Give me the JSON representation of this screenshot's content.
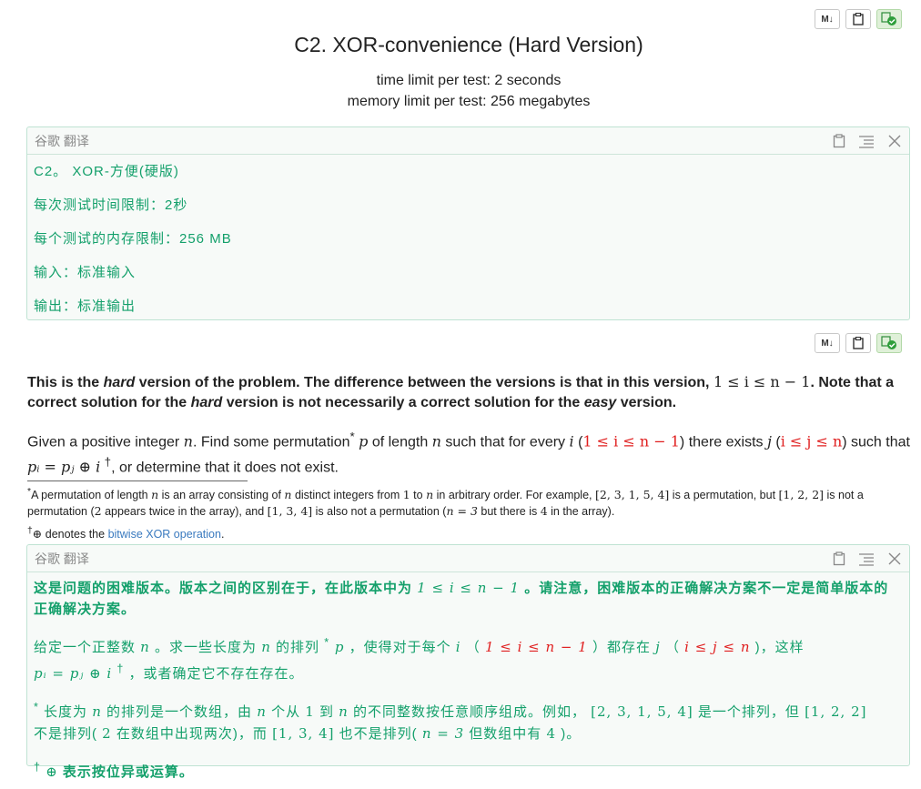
{
  "toolbar": {
    "md_label": "M↓"
  },
  "problem": {
    "title": "C2. XOR-convenience (Hard Version)",
    "time_limit": "time limit per test: 2 seconds",
    "memory_limit": "memory limit per test: 256 megabytes"
  },
  "translation1": {
    "header": "谷歌 翻译",
    "lines": [
      "C2。 XOR-方便(硬版)",
      "每次测试时间限制：2秒",
      "每个测试的内存限制：256 MB",
      "输入：标准输入",
      "输出：标准输出"
    ]
  },
  "statement": {
    "p1": {
      "a": "This is the ",
      "b": "hard",
      "c": " version of the problem. The difference between the versions is that in this version, ",
      "math": "1 ≤ i ≤ n − 1",
      "d": ". Note that a correct solution for the ",
      "e": "hard",
      "f": " version is not necessarily a correct solution for the ",
      "g": "easy",
      "h": " version."
    },
    "p2": {
      "a": "Given a positive integer ",
      "n": "n",
      "b": ". Find some permutation",
      "star": "*",
      "p": "p",
      "c": " of length ",
      "n2": "n",
      "d": " such that for every ",
      "i": "i",
      "e": " (",
      "cond1": "1 ≤ i ≤ n − 1",
      "f": ") there exists ",
      "j": "j",
      "g": " (",
      "cond2": "i ≤ j ≤ n",
      "h": ") such that",
      "eq": "pᵢ = pⱼ ⊕ i",
      "dagger": "†",
      "k": ", or determine that it does not exist."
    }
  },
  "footnotes": {
    "fn1": {
      "mark": "*",
      "a": "A permutation of length ",
      "n": "n",
      "b": " is an array consisting of ",
      "n2": "n",
      "c": " distinct integers from ",
      "one": "1",
      "d": " to ",
      "n3": "n",
      "e": " in arbitrary order. For example, ",
      "ex1": "[2, 3, 1, 5, 4]",
      "f": " is a permutation, but ",
      "ex2": "[1, 2, 2]",
      "g": " is not a permutation (",
      "two": "2",
      "h": " appears twice in the array), and ",
      "ex3": "[1, 3, 4]",
      "i": " is also not a permutation (",
      "n_eq": "n = 3",
      "j": " but there is ",
      "four": "4",
      "k": " in the array)."
    },
    "fn2": {
      "mark": "†",
      "sym": "⊕",
      "a": " denotes the ",
      "link": "bitwise XOR operation",
      "b": "."
    }
  },
  "translation2": {
    "header": "谷歌 翻译",
    "p1": {
      "a": "这是问题的困难版本。版本之间的区别在于，在此版本中为 ",
      "math": "1 ≤ i ≤ n − 1",
      "b": " 。请注意，困难版本的正确解决方案不一定是简单版本的正确解决方案。"
    },
    "p2": {
      "a": "给定一个正整数 ",
      "n": "n",
      "b": " 。求一些长度为 ",
      "n2": "n",
      "c": " 的排列 ",
      "star": "*",
      "p": " p",
      "d": " ，使得对于每个 ",
      "i": "i",
      "e": " （ ",
      "cond1": "1 ≤ i ≤ n − 1",
      "f": " ）都存在 ",
      "j": "j",
      "g": " （ ",
      "cond2": "i ≤ j ≤ n",
      "h": " )，这样",
      "eq": "pᵢ = pⱼ ⊕ i",
      "dagger": "†",
      "k": " ，或者确定它不存在存在。"
    },
    "p3": {
      "star": "*",
      "a": " 长度为 ",
      "n": "n",
      "b": " 的排列是一个数组，由 ",
      "n2": "n",
      "c": " 个从 ",
      "one": "1",
      "d": " 到 ",
      "n3": "n",
      "e": " 的不同整数按任意顺序组成。例如， ",
      "ex1": "[2, 3, 1, 5, 4]",
      "f": " 是一个排列，但 ",
      "ex2": "[1, 2, 2]",
      "g": "不是排列( ",
      "two": "2",
      "h": " 在数组中出现两次)，而 ",
      "ex3": "[1, 3, 4]",
      "i": " 也不是排列( ",
      "n_eq": "n = 3",
      "j": " 但数组中有 ",
      "four": "4",
      "k": " )。"
    },
    "p4": {
      "dagger": "†",
      "sym": "⊕",
      "a": " 表示按位异或运算。"
    }
  }
}
